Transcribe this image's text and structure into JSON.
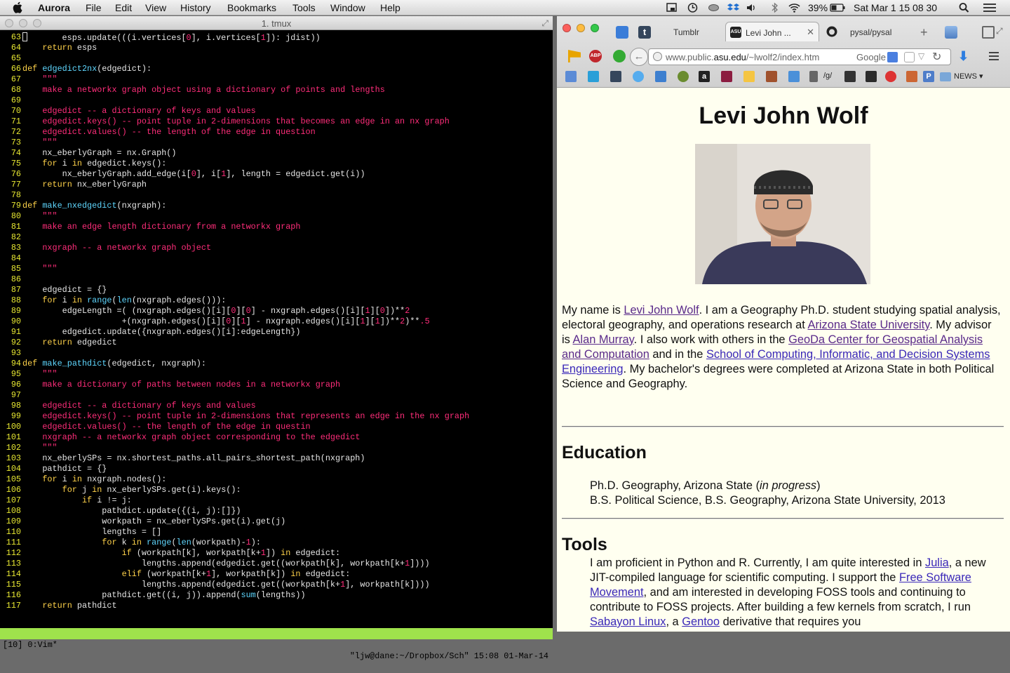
{
  "menubar": {
    "app": "Aurora",
    "items": [
      "File",
      "Edit",
      "View",
      "History",
      "Bookmarks",
      "Tools",
      "Window",
      "Help"
    ],
    "battery": "39%",
    "clock": "Sat Mar 1  15 08 30"
  },
  "terminal": {
    "title": "1. tmux",
    "lines": [
      {
        "n": "63",
        "h": "<span class=\"cursor\"></span>       esps.update(((i.vertices[<span class=\"num\">0</span>], i.vertices[<span class=\"num\">1</span>]): jdist))"
      },
      {
        "n": "64",
        "h": "    <span class=\"kw\">return</span> esps"
      },
      {
        "n": "65",
        "h": ""
      },
      {
        "n": "66",
        "h": "<span class=\"kw\">def</span> <span class=\"fn\">edgedict2nx</span>(edgedict):"
      },
      {
        "n": "67",
        "h": "    <span class=\"str\">\"\"\"</span>"
      },
      {
        "n": "68",
        "h": "    <span class=\"str\">make a networkx graph object using a dictionary of points and lengths</span>"
      },
      {
        "n": "69",
        "h": ""
      },
      {
        "n": "70",
        "h": "    <span class=\"str\">edgedict -- a dictionary of keys and values</span>"
      },
      {
        "n": "71",
        "h": "    <span class=\"str\">edgedict.keys() -- point tuple in 2-dimensions that becomes an edge in an nx graph</span>"
      },
      {
        "n": "72",
        "h": "    <span class=\"str\">edgedict.values() -- the length of the edge in question</span>"
      },
      {
        "n": "73",
        "h": "    <span class=\"str\">\"\"\"</span>"
      },
      {
        "n": "74",
        "h": "    nx_eberlyGraph = nx.Graph()"
      },
      {
        "n": "75",
        "h": "    <span class=\"kw\">for</span> i <span class=\"kw\">in</span> edgedict.keys():"
      },
      {
        "n": "76",
        "h": "        nx_eberlyGraph.add_edge(i[<span class=\"num\">0</span>], i[<span class=\"num\">1</span>], length = edgedict.get(i))"
      },
      {
        "n": "77",
        "h": "    <span class=\"kw\">return</span> nx_eberlyGraph"
      },
      {
        "n": "78",
        "h": ""
      },
      {
        "n": "79",
        "h": "<span class=\"kw\">def</span> <span class=\"fn\">make_nxedgedict</span>(nxgraph):"
      },
      {
        "n": "80",
        "h": "    <span class=\"str\">\"\"\"</span>"
      },
      {
        "n": "81",
        "h": "    <span class=\"str\">make an edge length dictionary from a networkx graph</span>"
      },
      {
        "n": "82",
        "h": ""
      },
      {
        "n": "83",
        "h": "    <span class=\"str\">nxgraph -- a networkx graph object</span>"
      },
      {
        "n": "84",
        "h": ""
      },
      {
        "n": "85",
        "h": "    <span class=\"str\">\"\"\"</span>"
      },
      {
        "n": "86",
        "h": ""
      },
      {
        "n": "87",
        "h": "    edgedict = {}"
      },
      {
        "n": "88",
        "h": "    <span class=\"kw\">for</span> i <span class=\"kw\">in</span> <span class=\"bi\">range</span>(<span class=\"bi\">len</span>(nxgraph.edges())):"
      },
      {
        "n": "89",
        "h": "        edgeLength =( (nxgraph.edges()[i][<span class=\"num\">0</span>][<span class=\"num\">0</span>] - nxgraph.edges()[i][<span class=\"num\">1</span>][<span class=\"num\">0</span>])**<span class=\"num\">2</span>"
      },
      {
        "n": "90",
        "h": "                    +(nxgraph.edges()[i][<span class=\"num\">0</span>][<span class=\"num\">1</span>] - nxgraph.edges()[i][<span class=\"num\">1</span>][<span class=\"num\">1</span>])**<span class=\"num\">2</span>)**<span class=\"num\">.5</span>"
      },
      {
        "n": "91",
        "h": "        edgedict.update({nxgraph.edges()[i]:edgeLength})"
      },
      {
        "n": "92",
        "h": "    <span class=\"kw\">return</span> edgedict"
      },
      {
        "n": "93",
        "h": ""
      },
      {
        "n": "94",
        "h": "<span class=\"kw\">def</span> <span class=\"fn\">make_pathdict</span>(edgedict, nxgraph):"
      },
      {
        "n": "95",
        "h": "    <span class=\"str\">\"\"\"</span>"
      },
      {
        "n": "96",
        "h": "    <span class=\"str\">make a dictionary of paths between nodes in a networkx graph</span>"
      },
      {
        "n": "97",
        "h": ""
      },
      {
        "n": "98",
        "h": "    <span class=\"str\">edgedict -- a dictionary of keys and values</span>"
      },
      {
        "n": "99",
        "h": "    <span class=\"str\">edgedict.keys() -- point tuple in 2-dimensions that represents an edge in the nx graph</span>"
      },
      {
        "n": "100",
        "h": "    <span class=\"str\">edgedict.values() -- the length of the edge in questin</span>"
      },
      {
        "n": "101",
        "h": "    <span class=\"str\">nxgraph -- a networkx graph object corresponding to the edgedict</span>"
      },
      {
        "n": "102",
        "h": "    <span class=\"str\">\"\"\"</span>"
      },
      {
        "n": "103",
        "h": "    nx_eberlySPs = nx.shortest_paths.all_pairs_shortest_path(nxgraph)"
      },
      {
        "n": "104",
        "h": "    pathdict = {}"
      },
      {
        "n": "105",
        "h": "    <span class=\"kw\">for</span> i <span class=\"kw\">in</span> nxgraph.nodes():"
      },
      {
        "n": "106",
        "h": "        <span class=\"kw\">for</span> j <span class=\"kw\">in</span> nx_eberlySPs.get(i).keys():"
      },
      {
        "n": "107",
        "h": "            <span class=\"kw\">if</span> i != j:"
      },
      {
        "n": "108",
        "h": "                pathdict.update({(i, j):[]})"
      },
      {
        "n": "109",
        "h": "                workpath = nx_eberlySPs.get(i).get(j)"
      },
      {
        "n": "110",
        "h": "                lengths = []"
      },
      {
        "n": "111",
        "h": "                <span class=\"kw\">for</span> k <span class=\"kw\">in</span> <span class=\"bi\">range</span>(<span class=\"bi\">len</span>(workpath)-<span class=\"num\">1</span>):"
      },
      {
        "n": "112",
        "h": "                    <span class=\"kw\">if</span> (workpath[k], workpath[k+<span class=\"num\">1</span>]) <span class=\"kw\">in</span> edgedict:"
      },
      {
        "n": "113",
        "h": "                        lengths.append(edgedict.get((workpath[k], workpath[k+<span class=\"num\">1</span>])))"
      },
      {
        "n": "114",
        "h": "                    <span class=\"kw\">elif</span> (workpath[k+<span class=\"num\">1</span>], workpath[k]) <span class=\"kw\">in</span> edgedict:"
      },
      {
        "n": "115",
        "h": "                        lengths.append(edgedict.get((workpath[k+<span class=\"num\">1</span>], workpath[k])))"
      },
      {
        "n": "116",
        "h": "                pathdict.get((i, j)).append(<span class=\"bi\">sum</span>(lengths))"
      },
      {
        "n": "117",
        "h": "    <span class=\"kw\">return</span> pathdict"
      }
    ],
    "status_left": "[10] 0:Vim*",
    "status_right": "\"ljw@dane:~/Dropbox/Sch\" 15:08 01-Mar-14"
  },
  "browser": {
    "tabs": [
      {
        "label": "Tumblr",
        "active": false
      },
      {
        "label": "Levi John ...",
        "active": true
      },
      {
        "label": "pysal/pysal",
        "active": false
      }
    ],
    "url_host": "www.public.",
    "url_domain": "asu.edu",
    "url_path": "/~lwolf2/index.htm",
    "search_engine": "Google",
    "bookmark_labels": [
      "/g/",
      "NEWS"
    ]
  },
  "page": {
    "title": "Levi John Wolf",
    "bio_html": "My name is <a class=\"v\">Levi John Wolf</a>. I am a Geography Ph.D. student studying spatial analysis, electoral geography, and operations research at <a class=\"v\">Arizona State University</a>. My advisor is <a class=\"v\">Alan Murray</a>. I also work with others in the <a class=\"v\">GeoDa Center for Geospatial Analysis and Computation</a> and in the <a>School of Computing, Informatic, and Decision Systems Engineering</a>. My bachelor's degrees were completed at Arizona State in both Political Science and Geography.",
    "education_heading": "Education",
    "edu_line1_html": "Ph.D. Geography, Arizona State (<i>in progress</i>)",
    "edu_line2": "B.S. Political Science, B.S. Geography, Arizona State University, 2013",
    "tools_heading": "Tools",
    "tools_html": "I am proficient in Python and R. Currently, I am quite interested in <a>Julia</a>, a new JIT-compiled language for scientific computing. I support the <a>Free Software Movement</a>, and am interested in developing FOSS tools and continuing to contribute to FOSS projects. After building a few kernels from scratch, I run <a>Sabayon Linux</a>, a <a>Gentoo</a> derivative that requires you"
  }
}
